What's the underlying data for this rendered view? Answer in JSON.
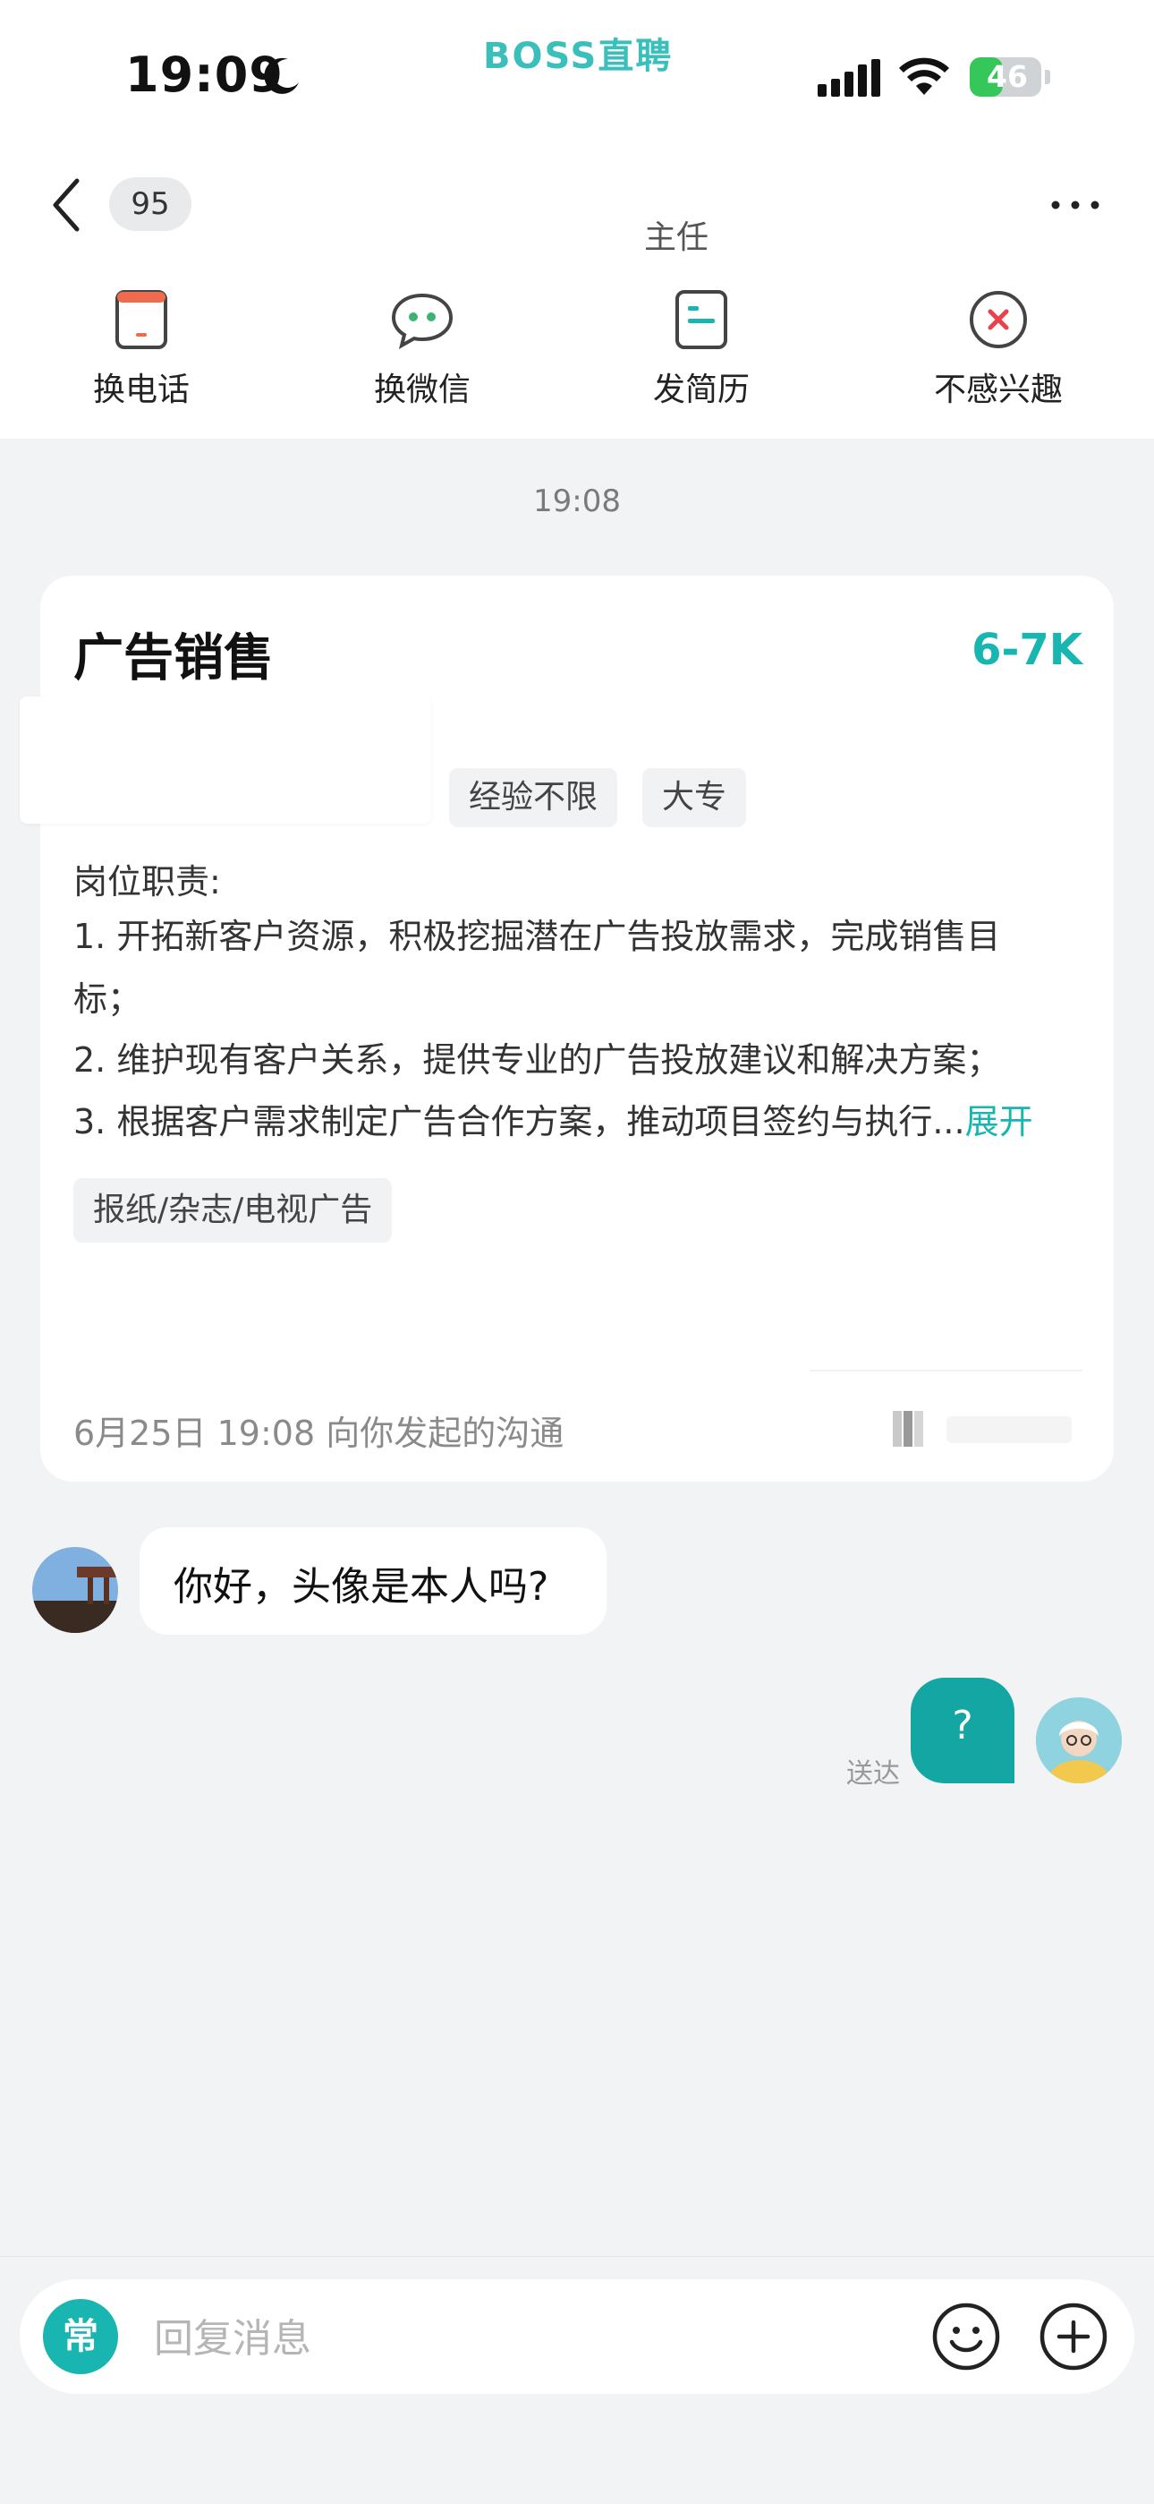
{
  "status_bar": {
    "time": "19:09",
    "watermark": "BOSS直聘",
    "battery": "46",
    "battery_level": 0.46
  },
  "header": {
    "unread_count": "95",
    "subtitle": "主任"
  },
  "actions": [
    {
      "label": "换电话",
      "icon": "phone-icon"
    },
    {
      "label": "换微信",
      "icon": "wechat-icon"
    },
    {
      "label": "发简历",
      "icon": "resume-icon"
    },
    {
      "label": "不感兴趣",
      "icon": "not-interested-icon"
    }
  ],
  "chat": {
    "timestamp": "19:08",
    "job_card": {
      "title": "广告销售",
      "salary": "6-7K",
      "tags": [
        "经验不限",
        "大专"
      ],
      "duty_title": "岗位职责:",
      "duties": [
        "1. 开拓新客户资源，积极挖掘潜在广告投放需求，完成销售目标；",
        "2. 维护现有客户关系，提供专业的广告投放建议和解决方案；",
        "3. 根据客户需求制定广告合作方案，推动项目签约与执行..."
      ],
      "expand_label": "展开",
      "industry_tag": "报纸/杂志/电视广告",
      "footer": "6月25日 19:08 向你发起的沟通"
    },
    "messages": [
      {
        "side": "left",
        "text": "你好，头像是本人吗?"
      },
      {
        "side": "right",
        "text": "?",
        "status": "送达"
      }
    ]
  },
  "input": {
    "common_label": "常",
    "placeholder": "回复消息"
  },
  "colors": {
    "accent": "#19b5b0",
    "bubble_right": "#14a6a2",
    "background": "#f2f3f5"
  }
}
